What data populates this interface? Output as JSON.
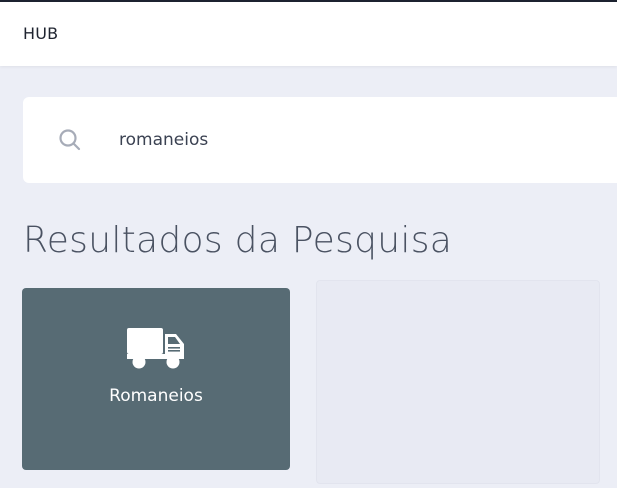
{
  "header": {
    "brand": "HUB"
  },
  "search": {
    "value": "romaneios",
    "icon": "search-icon"
  },
  "results": {
    "title": "Resultados da Pesquisa",
    "items": [
      {
        "label": "Romaneios",
        "icon": "truck-icon",
        "color": "#576b74"
      }
    ]
  },
  "colors": {
    "background": "#eceef6",
    "card": "#576b74"
  }
}
